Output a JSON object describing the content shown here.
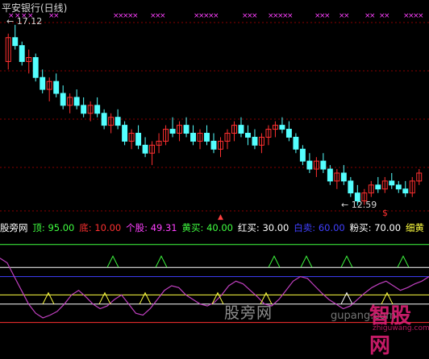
{
  "window": {
    "title": "平安银行(日线)"
  },
  "price_labels": {
    "high": "17.12",
    "low": "12.59",
    "marker": "$"
  },
  "indicator_legend": [
    {
      "key": "name",
      "text": "股旁网",
      "color": "#ffffff"
    },
    {
      "key": "top",
      "text": "顶: 95.00",
      "color": "#40ff40"
    },
    {
      "key": "bottom",
      "text": "底: 10.00",
      "color": "#ff3030"
    },
    {
      "key": "stock",
      "text": "个股: 49.31",
      "color": "#ff40ff"
    },
    {
      "key": "yellow_buy",
      "text": "黄买: 40.00",
      "color": "#40ff40"
    },
    {
      "key": "red_buy",
      "text": "红买: 30.00",
      "color": "#ffffff"
    },
    {
      "key": "white_sell",
      "text": "白卖: 60.00",
      "color": "#4040ff"
    },
    {
      "key": "pink_buy",
      "text": "粉买: 70.00",
      "color": "#ffffff"
    },
    {
      "key": "thin_yellow",
      "text": "细黄",
      "color": "#ffff40"
    }
  ],
  "watermark": {
    "text": "股旁网",
    "url": "gupang.com",
    "logo": "智股网",
    "logo_url": "zhiguwang.com"
  },
  "colors": {
    "background": "#000000",
    "candle_up": "#ff3030",
    "candle_down": "#54ffff",
    "grid": "#8b0000",
    "x_marker": "#ff40ff",
    "line_stock": "#c040c0"
  },
  "chart_data": {
    "type": "candlestick",
    "title": "平安银行(日线)",
    "high": 17.12,
    "low": 12.59,
    "ohlc": [
      [
        16.2,
        16.9,
        16.0,
        16.8
      ],
      [
        16.8,
        17.12,
        16.5,
        16.6
      ],
      [
        16.6,
        16.7,
        16.1,
        16.2
      ],
      [
        16.2,
        16.5,
        15.9,
        16.3
      ],
      [
        16.3,
        16.4,
        15.7,
        15.8
      ],
      [
        15.8,
        16.0,
        15.4,
        15.5
      ],
      [
        15.5,
        15.8,
        15.2,
        15.7
      ],
      [
        15.7,
        15.9,
        15.3,
        15.4
      ],
      [
        15.4,
        15.6,
        15.0,
        15.1
      ],
      [
        15.1,
        15.4,
        14.9,
        15.3
      ],
      [
        15.3,
        15.5,
        15.0,
        15.1
      ],
      [
        15.1,
        15.3,
        14.8,
        14.9
      ],
      [
        14.9,
        15.2,
        14.7,
        15.1
      ],
      [
        15.1,
        15.3,
        14.8,
        14.9
      ],
      [
        14.9,
        15.0,
        14.5,
        14.6
      ],
      [
        14.6,
        14.9,
        14.4,
        14.8
      ],
      [
        14.8,
        15.0,
        14.5,
        14.6
      ],
      [
        14.6,
        14.7,
        14.1,
        14.2
      ],
      [
        14.2,
        14.5,
        14.0,
        14.4
      ],
      [
        14.4,
        14.6,
        14.0,
        14.1
      ],
      [
        14.1,
        14.3,
        13.8,
        13.9
      ],
      [
        13.9,
        14.2,
        13.6,
        14.1
      ],
      [
        14.1,
        14.4,
        13.9,
        14.2
      ],
      [
        14.2,
        14.6,
        14.1,
        14.5
      ],
      [
        14.5,
        14.8,
        14.3,
        14.4
      ],
      [
        14.4,
        14.7,
        14.2,
        14.6
      ],
      [
        14.6,
        14.8,
        14.3,
        14.4
      ],
      [
        14.4,
        14.6,
        14.1,
        14.2
      ],
      [
        14.2,
        14.5,
        14.0,
        14.4
      ],
      [
        14.4,
        14.6,
        14.1,
        14.2
      ],
      [
        14.2,
        14.4,
        13.9,
        14.0
      ],
      [
        14.0,
        14.3,
        13.8,
        14.2
      ],
      [
        14.2,
        14.5,
        14.0,
        14.4
      ],
      [
        14.4,
        14.7,
        14.2,
        14.6
      ],
      [
        14.6,
        14.8,
        14.3,
        14.4
      ],
      [
        14.4,
        14.6,
        14.1,
        14.3
      ],
      [
        14.3,
        14.5,
        14.0,
        14.1
      ],
      [
        14.1,
        14.4,
        13.9,
        14.3
      ],
      [
        14.3,
        14.6,
        14.1,
        14.5
      ],
      [
        14.5,
        14.7,
        14.3,
        14.6
      ],
      [
        14.6,
        14.8,
        14.4,
        14.5
      ],
      [
        14.5,
        14.7,
        14.2,
        14.3
      ],
      [
        14.3,
        14.4,
        13.9,
        14.0
      ],
      [
        14.0,
        14.1,
        13.6,
        13.7
      ],
      [
        13.7,
        13.9,
        13.4,
        13.5
      ],
      [
        13.5,
        13.8,
        13.3,
        13.7
      ],
      [
        13.7,
        13.9,
        13.4,
        13.5
      ],
      [
        13.5,
        13.6,
        13.1,
        13.2
      ],
      [
        13.2,
        13.5,
        13.0,
        13.4
      ],
      [
        13.4,
        13.6,
        13.1,
        13.2
      ],
      [
        13.2,
        13.3,
        12.8,
        12.9
      ],
      [
        12.9,
        13.1,
        12.59,
        12.7
      ],
      [
        12.7,
        13.0,
        12.6,
        12.9
      ],
      [
        12.9,
        13.2,
        12.8,
        13.1
      ],
      [
        13.1,
        13.3,
        12.9,
        13.0
      ],
      [
        13.0,
        13.3,
        12.9,
        13.2
      ],
      [
        13.2,
        13.4,
        13.0,
        13.1
      ],
      [
        13.1,
        13.2,
        12.9,
        13.0
      ],
      [
        13.0,
        13.2,
        12.8,
        12.9
      ],
      [
        12.9,
        13.3,
        12.8,
        13.2
      ],
      [
        13.2,
        13.5,
        13.1,
        13.4
      ]
    ],
    "indicator": {
      "levels": [
        95,
        70,
        60,
        40,
        30,
        10
      ],
      "stock_value": 49.31,
      "series": [
        80,
        75,
        60,
        45,
        30,
        20,
        15,
        18,
        22,
        30,
        40,
        45,
        38,
        30,
        25,
        28,
        35,
        40,
        30,
        20,
        18,
        25,
        35,
        45,
        50,
        48,
        40,
        35,
        30,
        28,
        32,
        40,
        50,
        55,
        52,
        45,
        38,
        30,
        28,
        35,
        45,
        55,
        60,
        58,
        50,
        42,
        35,
        30,
        25,
        28,
        35,
        42,
        48,
        52,
        55,
        50,
        45,
        48,
        52,
        55,
        60
      ]
    }
  }
}
